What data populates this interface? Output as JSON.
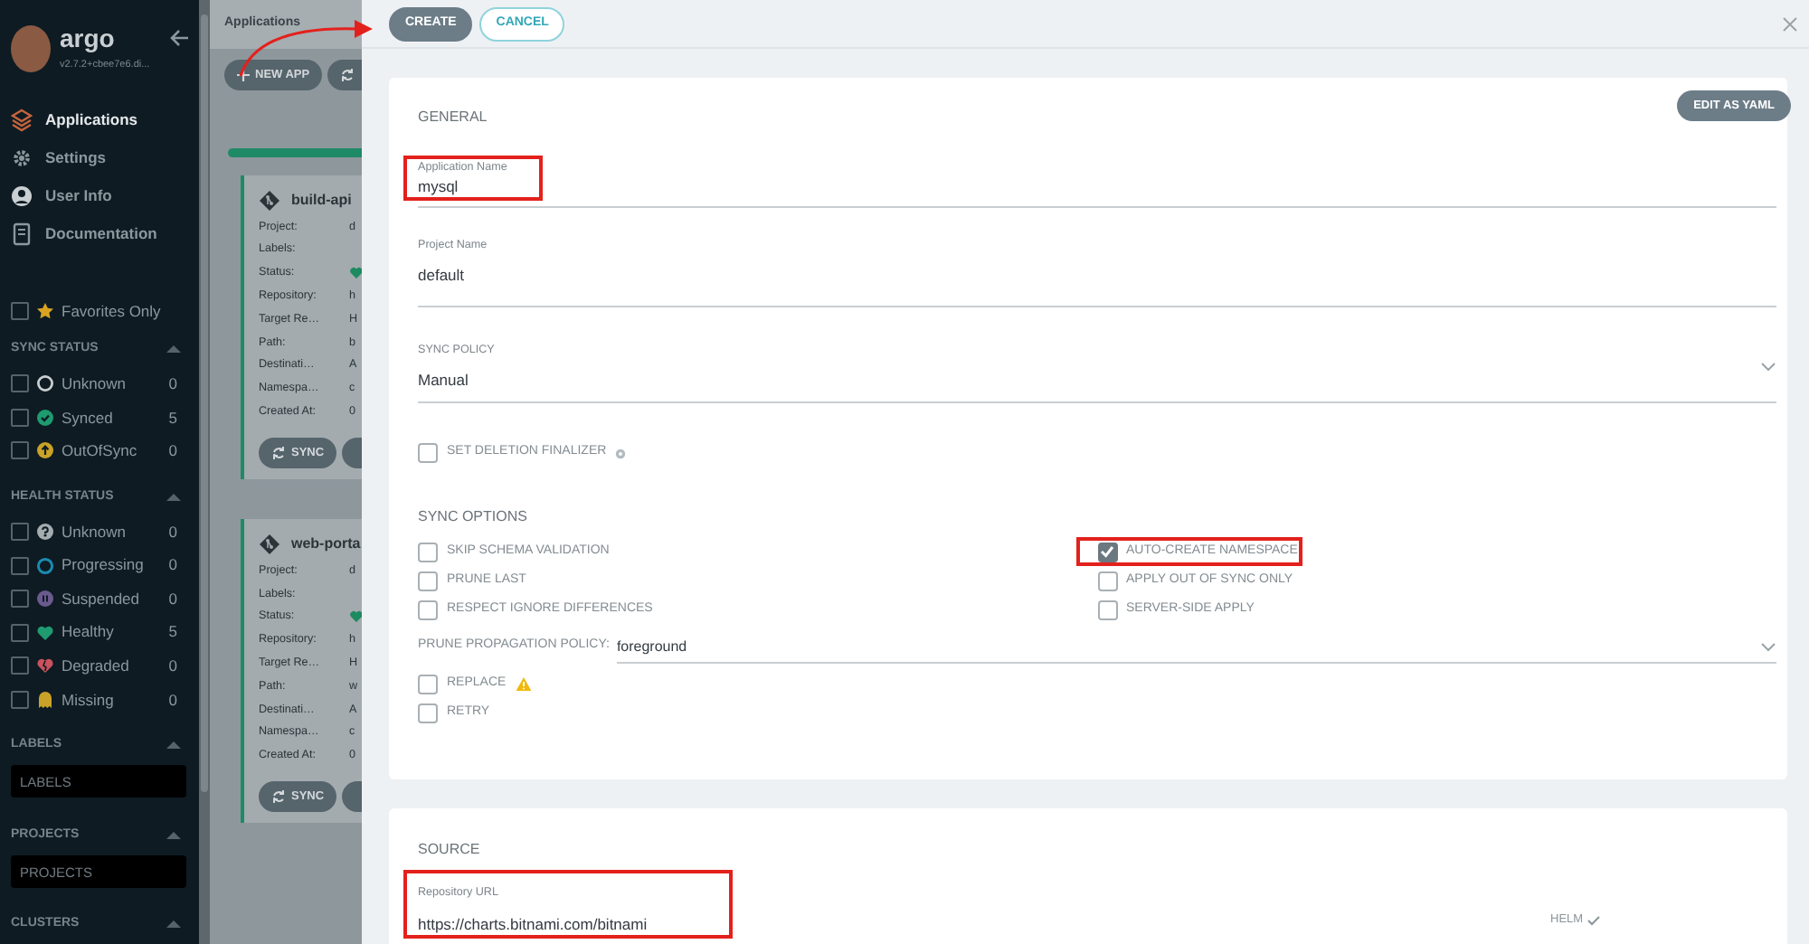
{
  "sidebar": {
    "brand": "argo",
    "version": "v2.7.2+cbee7e6.di...",
    "nav": [
      {
        "kind": "apps",
        "label": "Applications",
        "selected": true
      },
      {
        "kind": "settings",
        "label": "Settings",
        "selected": false
      },
      {
        "kind": "user",
        "label": "User Info",
        "selected": false
      },
      {
        "kind": "docs",
        "label": "Documentation",
        "selected": false
      }
    ],
    "favorites": {
      "label": "Favorites Only",
      "checked": false
    },
    "filter_groups": [
      {
        "title": "SYNC STATUS",
        "items": [
          {
            "kind": "unknown-sync",
            "label": "Unknown",
            "count": "0",
            "checked": false
          },
          {
            "kind": "synced",
            "label": "Synced",
            "count": "5",
            "checked": false
          },
          {
            "kind": "outofsync",
            "label": "OutOfSync",
            "count": "0",
            "checked": false
          }
        ]
      },
      {
        "title": "HEALTH STATUS",
        "items": [
          {
            "kind": "unknown-health",
            "label": "Unknown",
            "count": "0",
            "checked": false
          },
          {
            "kind": "progressing",
            "label": "Progressing",
            "count": "0",
            "checked": false
          },
          {
            "kind": "suspended",
            "label": "Suspended",
            "count": "0",
            "checked": false
          },
          {
            "kind": "healthy",
            "label": "Healthy",
            "count": "5",
            "checked": false
          },
          {
            "kind": "degraded",
            "label": "Degraded",
            "count": "0",
            "checked": false
          },
          {
            "kind": "missing",
            "label": "Missing",
            "count": "0",
            "checked": false
          }
        ]
      }
    ],
    "text_filters": [
      {
        "title": "LABELS",
        "placeholder": "LABELS"
      },
      {
        "title": "PROJECTS",
        "placeholder": "PROJECTS"
      }
    ],
    "more_sections": [
      "CLUSTERS"
    ]
  },
  "app_list": {
    "title": "Applications",
    "toolbar": [
      {
        "kind": "new",
        "label": "NEW APP"
      },
      {
        "kind": "sync"
      }
    ],
    "cards": [
      {
        "name": "build-api",
        "fields": [
          {
            "label": "Project:",
            "value": "d"
          },
          {
            "label": "Labels:"
          },
          {
            "label": "Status:",
            "kind": "heart"
          },
          {
            "label": "Repository:",
            "value": "h"
          },
          {
            "label": "Target Re…",
            "value": "H"
          },
          {
            "label": "Path:",
            "value": "b"
          },
          {
            "label": "Destinati…",
            "value": "A"
          },
          {
            "label": "Namespa…",
            "value": "c"
          },
          {
            "label": "Created At:",
            "value": "0"
          }
        ],
        "buttons": [
          {
            "kind": "sync",
            "label": "SYNC"
          },
          {
            "kind": "cut"
          }
        ]
      },
      {
        "name": "web-porta",
        "fields": [
          {
            "label": "Project:",
            "value": "d"
          },
          {
            "label": "Labels:"
          },
          {
            "label": "Status:",
            "kind": "heart"
          },
          {
            "label": "Repository:",
            "value": "h"
          },
          {
            "label": "Target Re…",
            "value": "H"
          },
          {
            "label": "Path:",
            "value": "w"
          },
          {
            "label": "Destinati…",
            "value": "A"
          },
          {
            "label": "Namespa…",
            "value": "c"
          },
          {
            "label": "Created At:",
            "value": "0"
          }
        ],
        "buttons": [
          {
            "kind": "sync",
            "label": "SYNC"
          },
          {
            "kind": "cut"
          }
        ]
      }
    ]
  },
  "panel": {
    "header_buttons": [
      {
        "kind": "primary",
        "label": "CREATE"
      },
      {
        "kind": "outline",
        "label": "CANCEL"
      }
    ],
    "general": {
      "title": "GENERAL",
      "edit_button": "EDIT AS YAML",
      "fields": [
        {
          "kind": "text",
          "label": "Application Name",
          "value": "mysql",
          "highlighted": true
        },
        {
          "kind": "text",
          "label": "Project Name",
          "value": "default",
          "highlighted": false
        },
        {
          "kind": "select",
          "label": "SYNC POLICY",
          "value": "Manual",
          "highlighted": false
        }
      ],
      "finalizer": {
        "label": "SET DELETION FINALIZER",
        "checked": false
      },
      "sync_options": {
        "title": "SYNC OPTIONS",
        "left": [
          {
            "label": "SKIP SCHEMA VALIDATION",
            "checked": false,
            "highlighted": false
          },
          {
            "label": "PRUNE LAST",
            "checked": false,
            "highlighted": false
          },
          {
            "label": "RESPECT IGNORE DIFFERENCES",
            "checked": false,
            "highlighted": false
          }
        ],
        "right": [
          {
            "label": "AUTO-CREATE NAMESPACE",
            "checked": true,
            "highlighted": true
          },
          {
            "label": "APPLY OUT OF SYNC ONLY",
            "checked": false,
            "highlighted": false
          },
          {
            "label": "SERVER-SIDE APPLY",
            "checked": false,
            "highlighted": false
          }
        ]
      },
      "prune_policy": {
        "label": "PRUNE PROPAGATION POLICY:",
        "value": "foreground"
      },
      "extra_options": [
        {
          "label": "REPLACE",
          "checked": false,
          "warning": true
        },
        {
          "label": "RETRY",
          "checked": false,
          "warning": false
        }
      ]
    },
    "source": {
      "title": "SOURCE",
      "fields": [
        {
          "kind": "text",
          "label": "Repository URL",
          "value": "https://charts.bitnami.com/bitnami",
          "highlighted": true
        }
      ],
      "type_label": "HELM"
    }
  }
}
